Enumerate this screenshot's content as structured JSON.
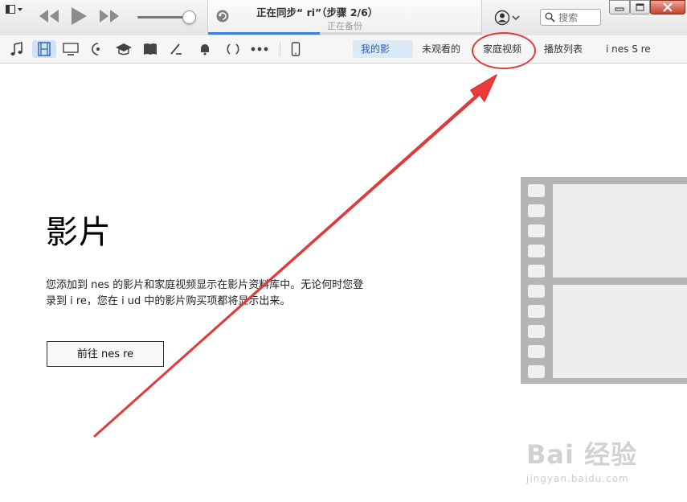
{
  "playback": {
    "now_syncing_title": "正在同步“     ri”（步骤 2/6）",
    "now_syncing_subtitle": "正在备份",
    "sync_progress": 0.41
  },
  "search": {
    "placeholder": "搜索"
  },
  "media_kinds": [
    {
      "name": "music-icon",
      "selected": false
    },
    {
      "name": "movies-icon",
      "selected": true
    },
    {
      "name": "tv-shows-icon",
      "selected": false
    },
    {
      "name": "podcasts-icon",
      "selected": false
    },
    {
      "name": "itunes-u-icon",
      "selected": false
    },
    {
      "name": "audiobooks-icon",
      "selected": false
    },
    {
      "name": "apps-icon",
      "selected": false
    },
    {
      "name": "tones-icon",
      "selected": false
    },
    {
      "name": "radio-icon",
      "selected": false
    },
    {
      "name": "more-icon",
      "selected": false
    },
    {
      "name": "device-icon",
      "selected": false
    }
  ],
  "nav": {
    "tabs": [
      {
        "label": "我的影",
        "active": true
      },
      {
        "label": "未观看的",
        "active": false
      },
      {
        "label": "家庭视频",
        "active": false
      },
      {
        "label": "播放列表",
        "active": false
      },
      {
        "label": "i nes S re",
        "active": false
      }
    ]
  },
  "main": {
    "title": "影片",
    "description_line1": "您添加到    nes 的影片和家庭视频显示在影片资料库中。无论何时您登",
    "description_line2": "录到 i      re，您在 i   ud 中的影片购买项都将显示出来。",
    "button_label": "前往     nes re"
  },
  "watermark": {
    "logo": "Bai 经验",
    "url": "jingyan.baidu.com"
  },
  "colors": {
    "accent_blue": "#3b7fdc",
    "annotation_red": "#e03a3a",
    "film_gray": "#b5b5b5"
  }
}
